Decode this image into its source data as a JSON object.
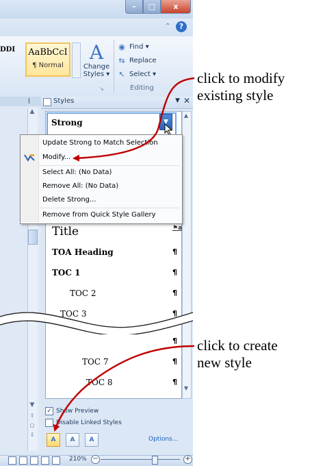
{
  "window": {
    "minimize_glyph": "–",
    "maximize_glyph": "□",
    "close_glyph": "x",
    "help_glyph": "?",
    "ribbon_min_glyph": "⌃"
  },
  "ribbon": {
    "gallery_prev_sample": "DDI",
    "gallery_selected_sample": "AaBbCcI",
    "gallery_selected_label": "¶ Normal",
    "change_styles_label": "Change Styles ▾",
    "change_styles_icon": "A",
    "editing": {
      "find_label": "Find ▾",
      "replace_label": "Replace",
      "select_label": "Select ▾",
      "group_label": "Editing"
    }
  },
  "styles_pane": {
    "title": "Styles",
    "menu_glyph": "▼",
    "close_glyph": "✕",
    "selected_style": "Strong",
    "items": [
      {
        "name": "Title",
        "mark": "⚑a"
      },
      {
        "name": "TOA Heading",
        "mark": "¶"
      },
      {
        "name": "TOC 1",
        "mark": "¶"
      },
      {
        "name": "TOC 2",
        "mark": "¶"
      },
      {
        "name": "TOC 3",
        "mark": "¶"
      },
      {
        "name": "",
        "mark": "¶"
      },
      {
        "name": "TOC 7",
        "mark": "¶"
      },
      {
        "name": "TOC 8",
        "mark": "¶"
      }
    ],
    "show_preview_label": "Show Preview",
    "show_preview_checked": true,
    "disable_linked_label": "Disable Linked Styles",
    "disable_linked_checked": false,
    "new_style_glyph": "A",
    "inspector_glyph": "A",
    "manage_glyph": "A",
    "options_label": "Options..."
  },
  "context_menu": {
    "items": [
      "Update Strong to Match Selection",
      "Modify...",
      "Select All: (No Data)",
      "Remove All: (No Data)",
      "Delete Strong...",
      "Remove from Quick Style Gallery"
    ]
  },
  "status_bar": {
    "zoom_label": "210%",
    "minus_glyph": "−",
    "plus_glyph": "+"
  },
  "annotations": {
    "modify_line1": "click to modify",
    "modify_line2": "existing style",
    "create_line1": "click to create",
    "create_line2": "new style"
  },
  "colors": {
    "accent": "#2a64b8",
    "arrow": "#c00000",
    "selected_gallery": "#ffe69a"
  }
}
